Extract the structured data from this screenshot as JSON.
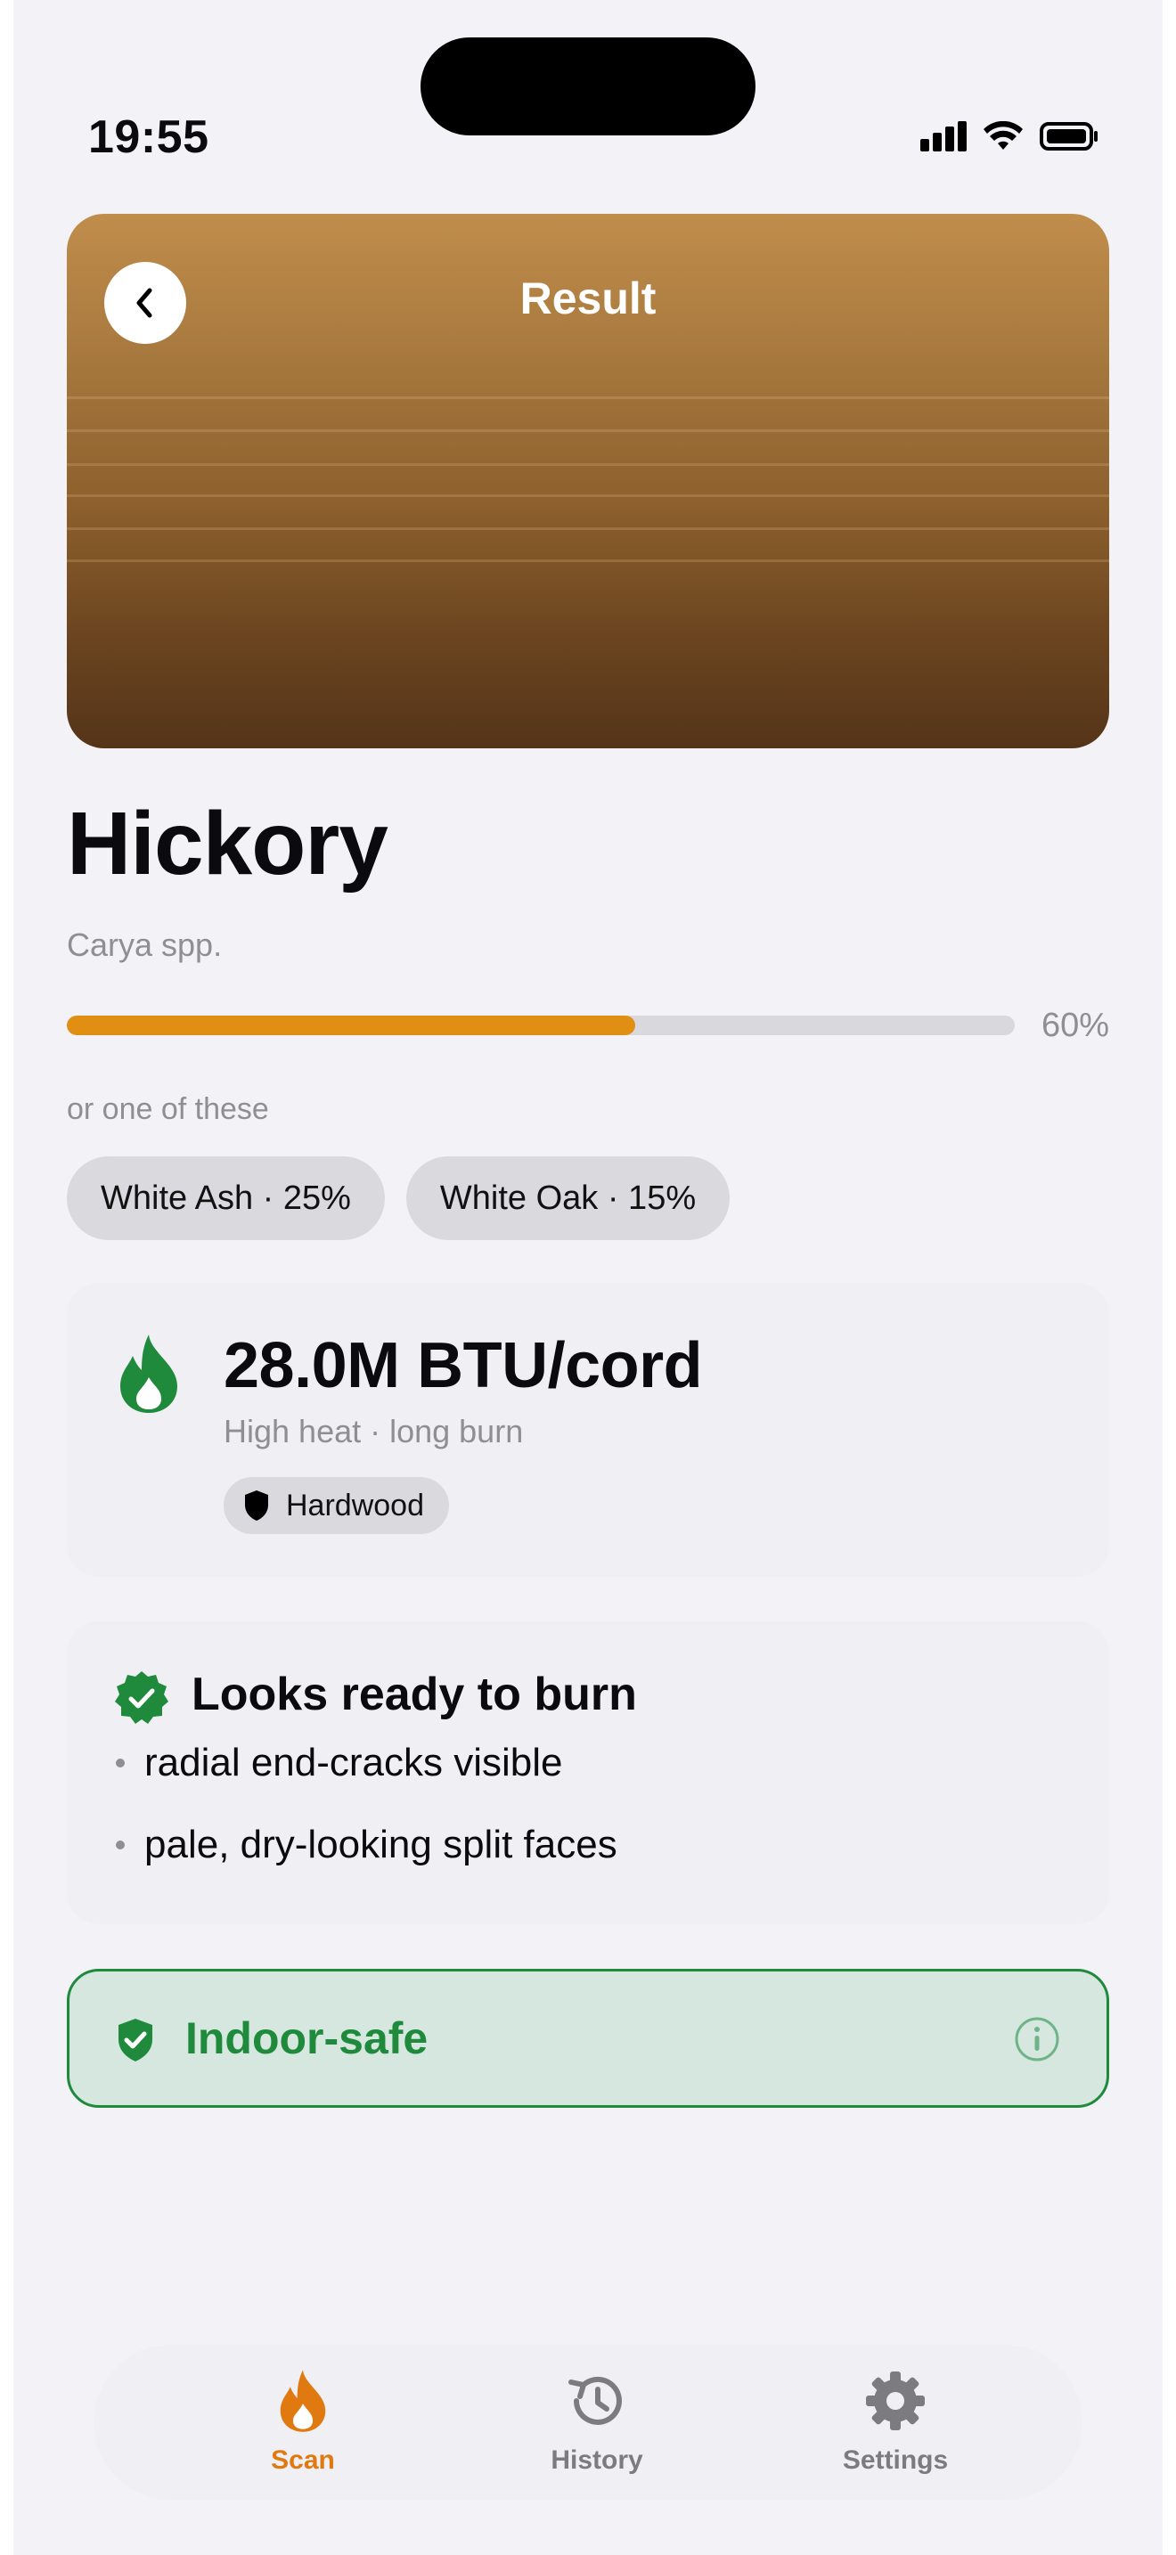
{
  "status_bar": {
    "time": "19:55"
  },
  "header": {
    "title": "Result"
  },
  "result": {
    "species": "Hickory",
    "scientific_name": "Carya spp.",
    "confidence": 0.6,
    "confidence_label": "60%",
    "alternatives_label": "or one of these",
    "alternatives": [
      {
        "label": "White Ash · 25%"
      },
      {
        "label": "White Oak · 15%"
      }
    ]
  },
  "heat": {
    "value": "28.0M BTU/cord",
    "description": "High heat · long burn",
    "type_badge": "Hardwood"
  },
  "readiness": {
    "title": "Looks ready to burn",
    "reasons": [
      "radial end-cracks visible",
      "pale, dry-looking split faces"
    ]
  },
  "safety": {
    "label": "Indoor-safe"
  },
  "tabs": [
    {
      "label": "Scan",
      "icon": "flame-icon",
      "active": true
    },
    {
      "label": "History",
      "icon": "history-icon",
      "active": false
    },
    {
      "label": "Settings",
      "icon": "gear-icon",
      "active": false
    }
  ],
  "colors": {
    "accent": "#e08f12",
    "success": "#1f8a3c",
    "active_tab": "#e07a10",
    "inactive_tab": "#7c7c80"
  }
}
